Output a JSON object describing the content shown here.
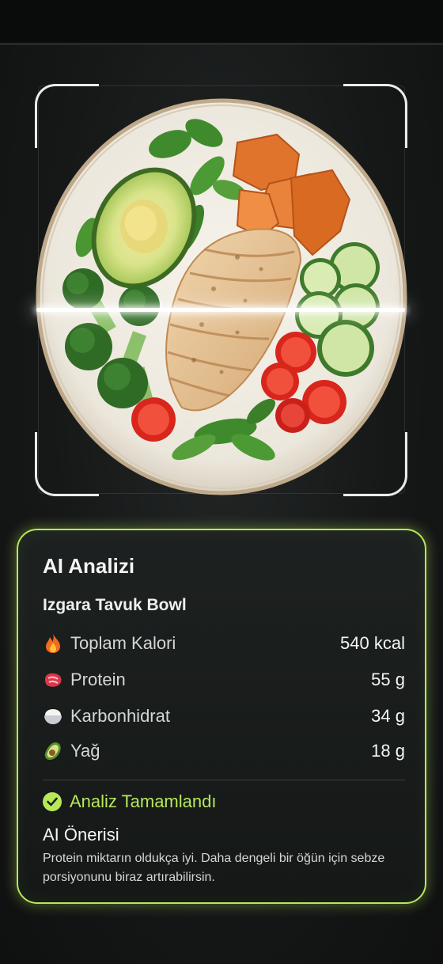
{
  "analysis": {
    "title": "AI Analizi",
    "meal_name": "Izgara Tavuk Bowl",
    "nutrients": [
      {
        "label": "Toplam Kalori",
        "value": "540 kcal",
        "icon": "fire-icon"
      },
      {
        "label": "Protein",
        "value": "55 g",
        "icon": "meat-icon"
      },
      {
        "label": "Karbonhidrat",
        "value": "34 g",
        "icon": "rice-icon"
      },
      {
        "label": "Yağ",
        "value": "18 g",
        "icon": "avocado-icon"
      }
    ],
    "status": "Analiz Tamamlandı",
    "suggestion_title": "AI Önerisi",
    "suggestion_text": "Protein miktarın oldukça iyi. Daha dengeli bir öğün için sebze porsiyonunu biraz artırabilirsin."
  },
  "colors": {
    "accent": "#b6e85a",
    "background": "#161818",
    "card": "#1b1e1d"
  }
}
